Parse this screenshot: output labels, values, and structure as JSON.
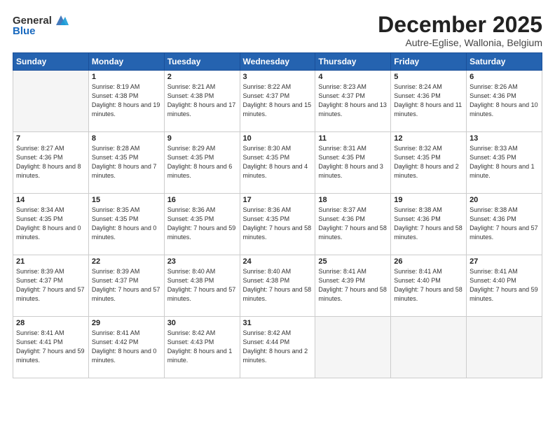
{
  "header": {
    "logo_general": "General",
    "logo_blue": "Blue",
    "month": "December 2025",
    "location": "Autre-Eglise, Wallonia, Belgium"
  },
  "days_of_week": [
    "Sunday",
    "Monday",
    "Tuesday",
    "Wednesday",
    "Thursday",
    "Friday",
    "Saturday"
  ],
  "weeks": [
    [
      {
        "day": null,
        "info": null
      },
      {
        "day": "1",
        "sunrise": "8:19 AM",
        "sunset": "4:38 PM",
        "daylight": "8 hours and 19 minutes."
      },
      {
        "day": "2",
        "sunrise": "8:21 AM",
        "sunset": "4:38 PM",
        "daylight": "8 hours and 17 minutes."
      },
      {
        "day": "3",
        "sunrise": "8:22 AM",
        "sunset": "4:37 PM",
        "daylight": "8 hours and 15 minutes."
      },
      {
        "day": "4",
        "sunrise": "8:23 AM",
        "sunset": "4:37 PM",
        "daylight": "8 hours and 13 minutes."
      },
      {
        "day": "5",
        "sunrise": "8:24 AM",
        "sunset": "4:36 PM",
        "daylight": "8 hours and 11 minutes."
      },
      {
        "day": "6",
        "sunrise": "8:26 AM",
        "sunset": "4:36 PM",
        "daylight": "8 hours and 10 minutes."
      }
    ],
    [
      {
        "day": "7",
        "sunrise": "8:27 AM",
        "sunset": "4:36 PM",
        "daylight": "8 hours and 8 minutes."
      },
      {
        "day": "8",
        "sunrise": "8:28 AM",
        "sunset": "4:35 PM",
        "daylight": "8 hours and 7 minutes."
      },
      {
        "day": "9",
        "sunrise": "8:29 AM",
        "sunset": "4:35 PM",
        "daylight": "8 hours and 6 minutes."
      },
      {
        "day": "10",
        "sunrise": "8:30 AM",
        "sunset": "4:35 PM",
        "daylight": "8 hours and 4 minutes."
      },
      {
        "day": "11",
        "sunrise": "8:31 AM",
        "sunset": "4:35 PM",
        "daylight": "8 hours and 3 minutes."
      },
      {
        "day": "12",
        "sunrise": "8:32 AM",
        "sunset": "4:35 PM",
        "daylight": "8 hours and 2 minutes."
      },
      {
        "day": "13",
        "sunrise": "8:33 AM",
        "sunset": "4:35 PM",
        "daylight": "8 hours and 1 minute."
      }
    ],
    [
      {
        "day": "14",
        "sunrise": "8:34 AM",
        "sunset": "4:35 PM",
        "daylight": "8 hours and 0 minutes."
      },
      {
        "day": "15",
        "sunrise": "8:35 AM",
        "sunset": "4:35 PM",
        "daylight": "8 hours and 0 minutes."
      },
      {
        "day": "16",
        "sunrise": "8:36 AM",
        "sunset": "4:35 PM",
        "daylight": "7 hours and 59 minutes."
      },
      {
        "day": "17",
        "sunrise": "8:36 AM",
        "sunset": "4:35 PM",
        "daylight": "7 hours and 58 minutes."
      },
      {
        "day": "18",
        "sunrise": "8:37 AM",
        "sunset": "4:36 PM",
        "daylight": "7 hours and 58 minutes."
      },
      {
        "day": "19",
        "sunrise": "8:38 AM",
        "sunset": "4:36 PM",
        "daylight": "7 hours and 58 minutes."
      },
      {
        "day": "20",
        "sunrise": "8:38 AM",
        "sunset": "4:36 PM",
        "daylight": "7 hours and 57 minutes."
      }
    ],
    [
      {
        "day": "21",
        "sunrise": "8:39 AM",
        "sunset": "4:37 PM",
        "daylight": "7 hours and 57 minutes."
      },
      {
        "day": "22",
        "sunrise": "8:39 AM",
        "sunset": "4:37 PM",
        "daylight": "7 hours and 57 minutes."
      },
      {
        "day": "23",
        "sunrise": "8:40 AM",
        "sunset": "4:38 PM",
        "daylight": "7 hours and 57 minutes."
      },
      {
        "day": "24",
        "sunrise": "8:40 AM",
        "sunset": "4:38 PM",
        "daylight": "7 hours and 58 minutes."
      },
      {
        "day": "25",
        "sunrise": "8:41 AM",
        "sunset": "4:39 PM",
        "daylight": "7 hours and 58 minutes."
      },
      {
        "day": "26",
        "sunrise": "8:41 AM",
        "sunset": "4:40 PM",
        "daylight": "7 hours and 58 minutes."
      },
      {
        "day": "27",
        "sunrise": "8:41 AM",
        "sunset": "4:40 PM",
        "daylight": "7 hours and 59 minutes."
      }
    ],
    [
      {
        "day": "28",
        "sunrise": "8:41 AM",
        "sunset": "4:41 PM",
        "daylight": "7 hours and 59 minutes."
      },
      {
        "day": "29",
        "sunrise": "8:41 AM",
        "sunset": "4:42 PM",
        "daylight": "8 hours and 0 minutes."
      },
      {
        "day": "30",
        "sunrise": "8:42 AM",
        "sunset": "4:43 PM",
        "daylight": "8 hours and 1 minute."
      },
      {
        "day": "31",
        "sunrise": "8:42 AM",
        "sunset": "4:44 PM",
        "daylight": "8 hours and 2 minutes."
      },
      {
        "day": null,
        "info": null
      },
      {
        "day": null,
        "info": null
      },
      {
        "day": null,
        "info": null
      }
    ]
  ]
}
